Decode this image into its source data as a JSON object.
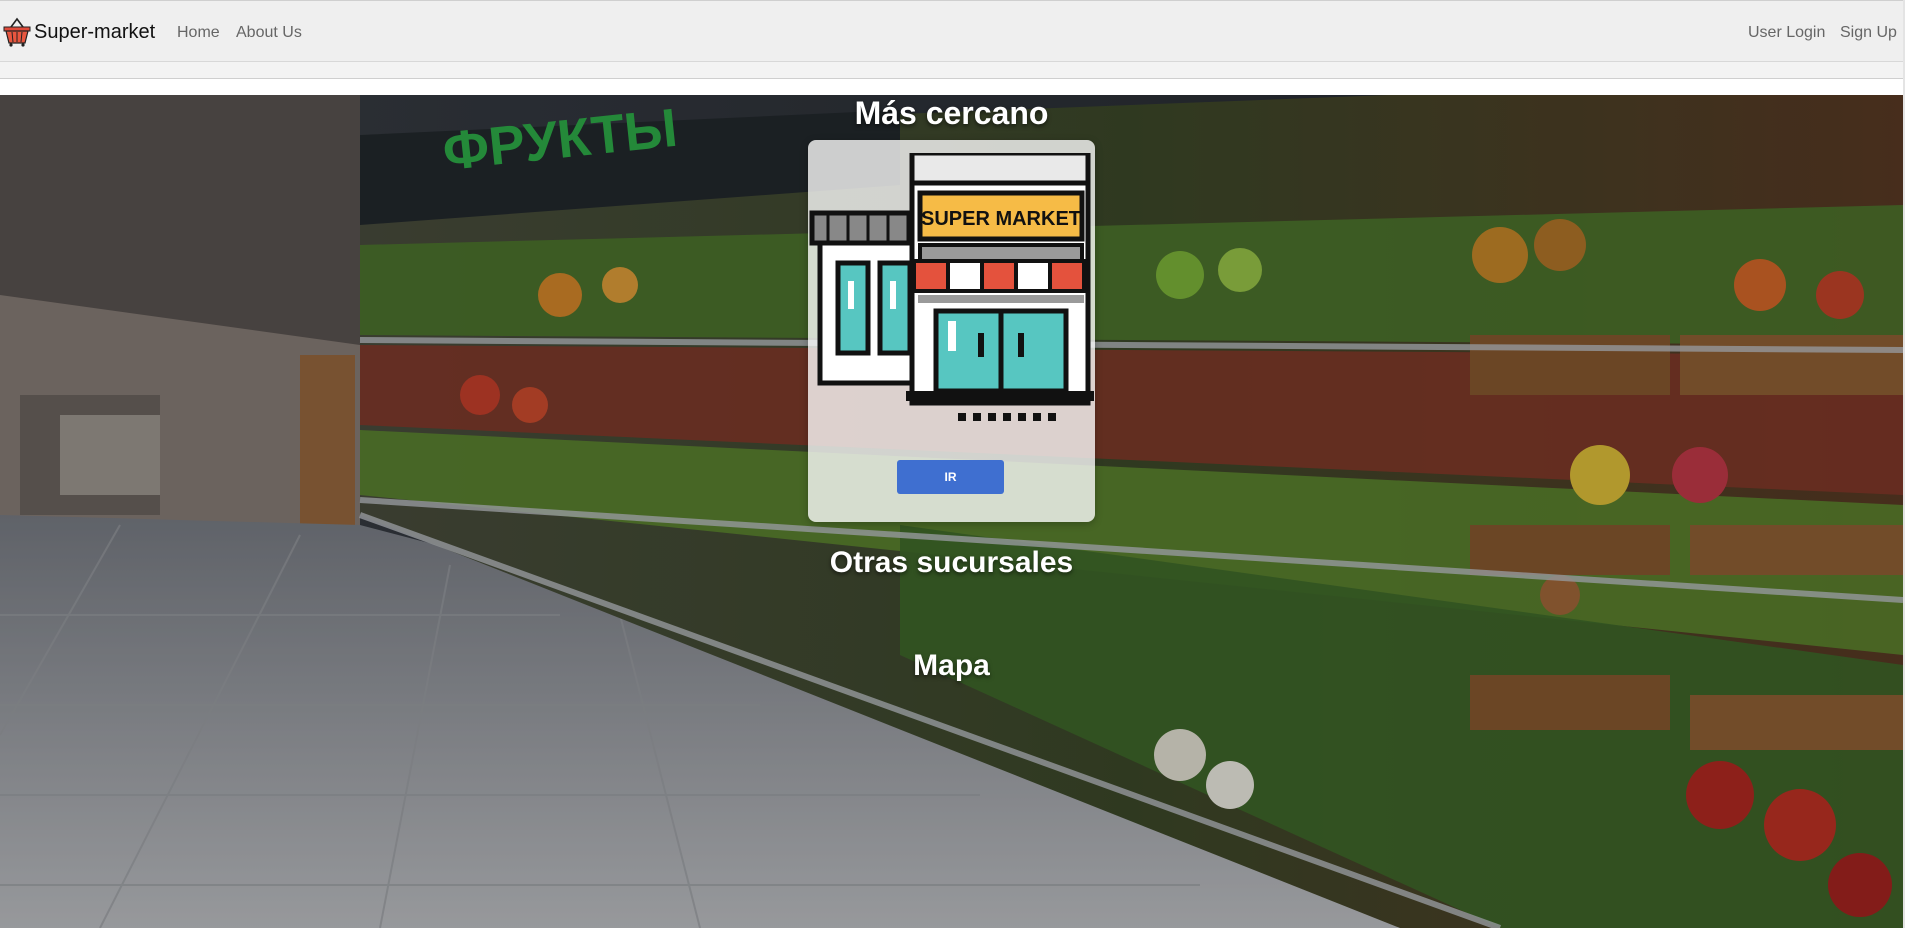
{
  "navbar": {
    "brand_name": "Super-market",
    "brand_icon": "shopping-basket-icon",
    "links": [
      "Home",
      "About Us"
    ],
    "auth_links": [
      "User Login",
      "Sign Up"
    ]
  },
  "hero": {
    "nearest_heading": "Más cercano",
    "card": {
      "illustration": "supermarket-storefront-icon",
      "sign_text": "SUPER MARKET",
      "button_label": "IR",
      "button_color": "#3f6fd0"
    },
    "branches_heading": "Otras sucursales",
    "map_heading": "Mapa",
    "background_sign_text": "ФРУКТЫ"
  }
}
